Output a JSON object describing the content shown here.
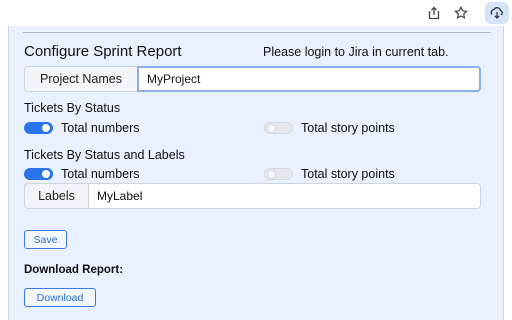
{
  "browser_toolbar": {
    "icons": [
      "share-icon",
      "star-icon",
      "extension-icon"
    ]
  },
  "popup": {
    "title": "Configure Sprint Report",
    "login_message": "Please login to Jira in current tab.",
    "project": {
      "label": "Project Names",
      "value": "MyProject"
    },
    "tickets_by_status": {
      "heading": "Tickets By Status",
      "total_numbers": {
        "label": "Total numbers",
        "on": true
      },
      "total_story_points": {
        "label": "Total story points",
        "on": false
      }
    },
    "tickets_by_status_labels": {
      "heading": "Tickets By Status and Labels",
      "total_numbers": {
        "label": "Total numbers",
        "on": true
      },
      "total_story_points": {
        "label": "Total story points",
        "on": false
      }
    },
    "labels": {
      "label": "Labels",
      "value": "MyLabel"
    },
    "save_label": "Save",
    "download_heading": "Download Report:",
    "download_label": "Download"
  },
  "colors": {
    "popup_background": "#e8f1fd",
    "accent": "#2a73e8"
  }
}
